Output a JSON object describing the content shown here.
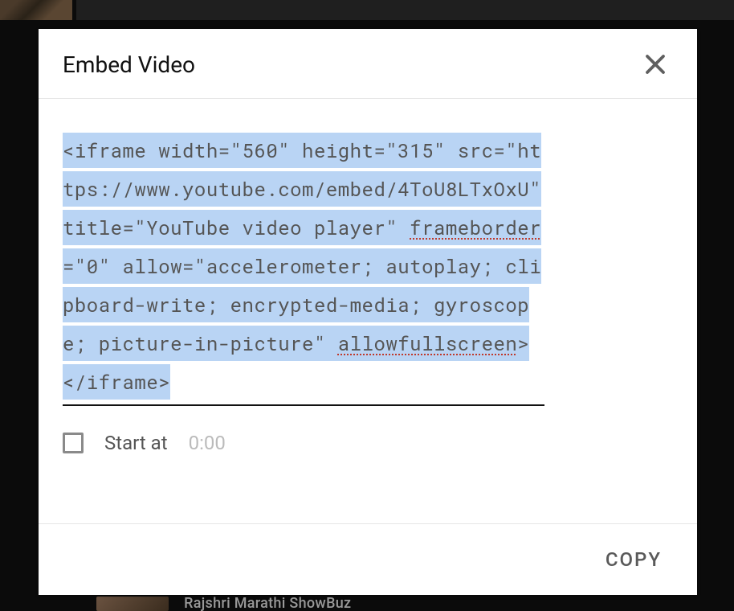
{
  "modal": {
    "title": "Embed Video",
    "close_icon": "close-icon",
    "embed_code_plain": "<iframe width=\"560\" height=\"315\" src=\"https://www.youtube.com/embed/4ToU8LTxOxU\" title=\"YouTube video player\" frameborder=\"0\" allow=\"accelerometer; autoplay; clipboard-write; encrypted-media; gyroscope; picture-in-picture\" allowfullscreen></iframe>",
    "embed_code_segments": [
      {
        "text": "<iframe width=\"560\" height=\"315\" src=\"https://www.youtube.com/embed/4ToU8LTxOxU\" title=\"YouTube video player\" ",
        "squiggle": false
      },
      {
        "text": "frameborder",
        "squiggle": true
      },
      {
        "text": "=\"0\" allow=\"accelerometer; autoplay; clipboard-write; encrypted-media; gyroscope; picture-in-picture\" ",
        "squiggle": false
      },
      {
        "text": "allowfullscreen",
        "squiggle": true
      },
      {
        "text": "></iframe>",
        "squiggle": false
      }
    ],
    "start_at": {
      "checked": false,
      "label": "Start at",
      "time": "0:00"
    },
    "copy_label": "COPY"
  },
  "background": {
    "bottom_text": "Rajshri Marathi ShowBuz"
  }
}
